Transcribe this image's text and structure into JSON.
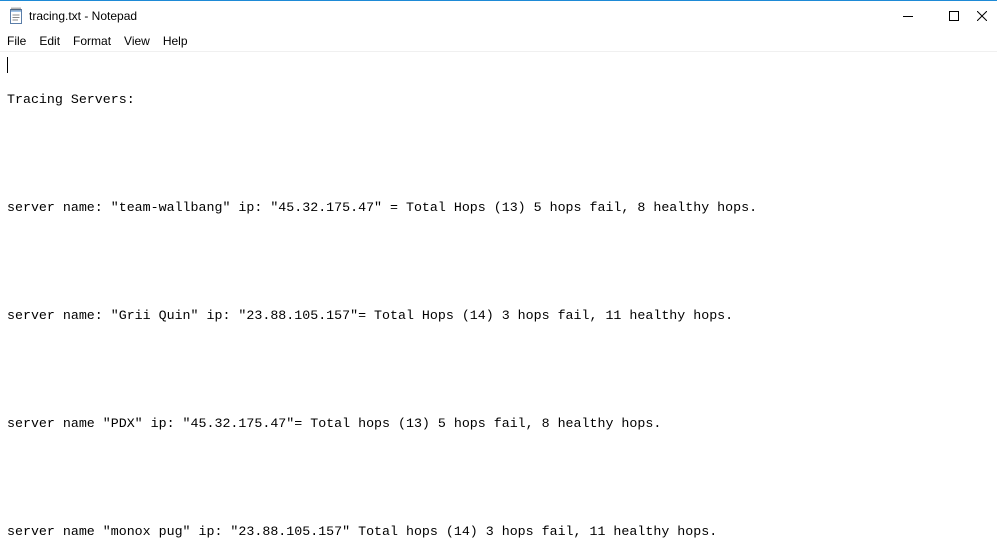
{
  "window": {
    "title": "tracing.txt - Notepad",
    "icon": "notepad-icon",
    "controls": {
      "minimize_icon": "minimize-icon",
      "maximize_icon": "maximize-icon",
      "close_icon": "close-icon"
    }
  },
  "menu": {
    "items": [
      "File",
      "Edit",
      "Format",
      "View",
      "Help"
    ]
  },
  "document": {
    "lines": [
      "Tracing Servers:",
      "",
      "server name: \"team-wallbang\" ip: \"45.32.175.47\" = Total Hops (13) 5 hops fail, 8 healthy hops.",
      "",
      "server name: \"Grii Quin\" ip: \"23.88.105.157\"= Total Hops (14) 3 hops fail, 11 healthy hops.",
      "",
      "server name \"PDX\" ip: \"45.32.175.47\"= Total hops (13) 5 hops fail, 8 healthy hops.",
      "",
      "server name \"monox pug\" ip: \"23.88.105.157\" Total hops (14) 3 hops fail, 11 healthy hops."
    ]
  },
  "colors": {
    "window_border": "#1e8ad6",
    "background": "#ffffff",
    "text": "#000000"
  }
}
